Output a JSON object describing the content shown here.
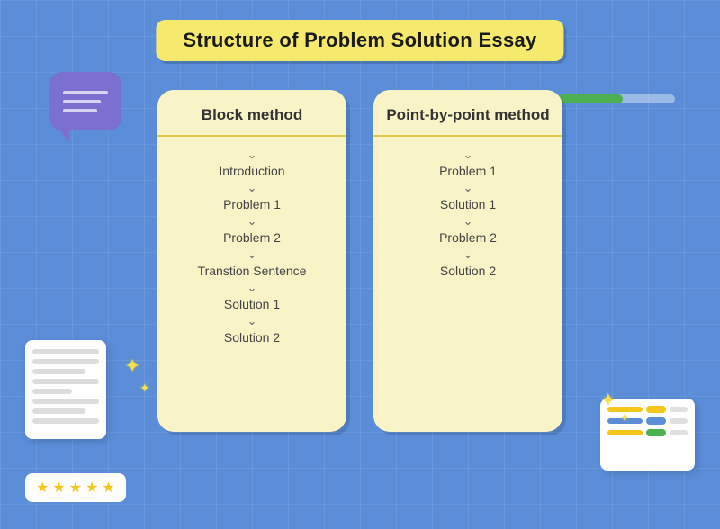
{
  "title": "Structure of Problem Solution Essay",
  "block_method": {
    "header": "Block method",
    "items": [
      "Introduction",
      "Problem 1",
      "Problem 2",
      "Transtion Sentence",
      "Solution 1",
      "Solution 2"
    ]
  },
  "point_method": {
    "header": "Point-by-point method",
    "items": [
      "Problem 1",
      "Solution 1",
      "Problem 2",
      "Solution 2"
    ]
  },
  "stars": [
    "★",
    "★",
    "★",
    "★",
    "★"
  ],
  "progress": {
    "fill_width": "55%"
  },
  "bubble_lines": [
    50,
    70,
    60
  ],
  "dashboard_rows": [
    {
      "line_color": "#f5c518",
      "pill_color": "#f5c518"
    },
    {
      "line_color": "#5b8dd9",
      "pill_color": "#5b8dd9"
    },
    {
      "line_color": "#f5c518",
      "pill_color": "#4caf50"
    }
  ]
}
